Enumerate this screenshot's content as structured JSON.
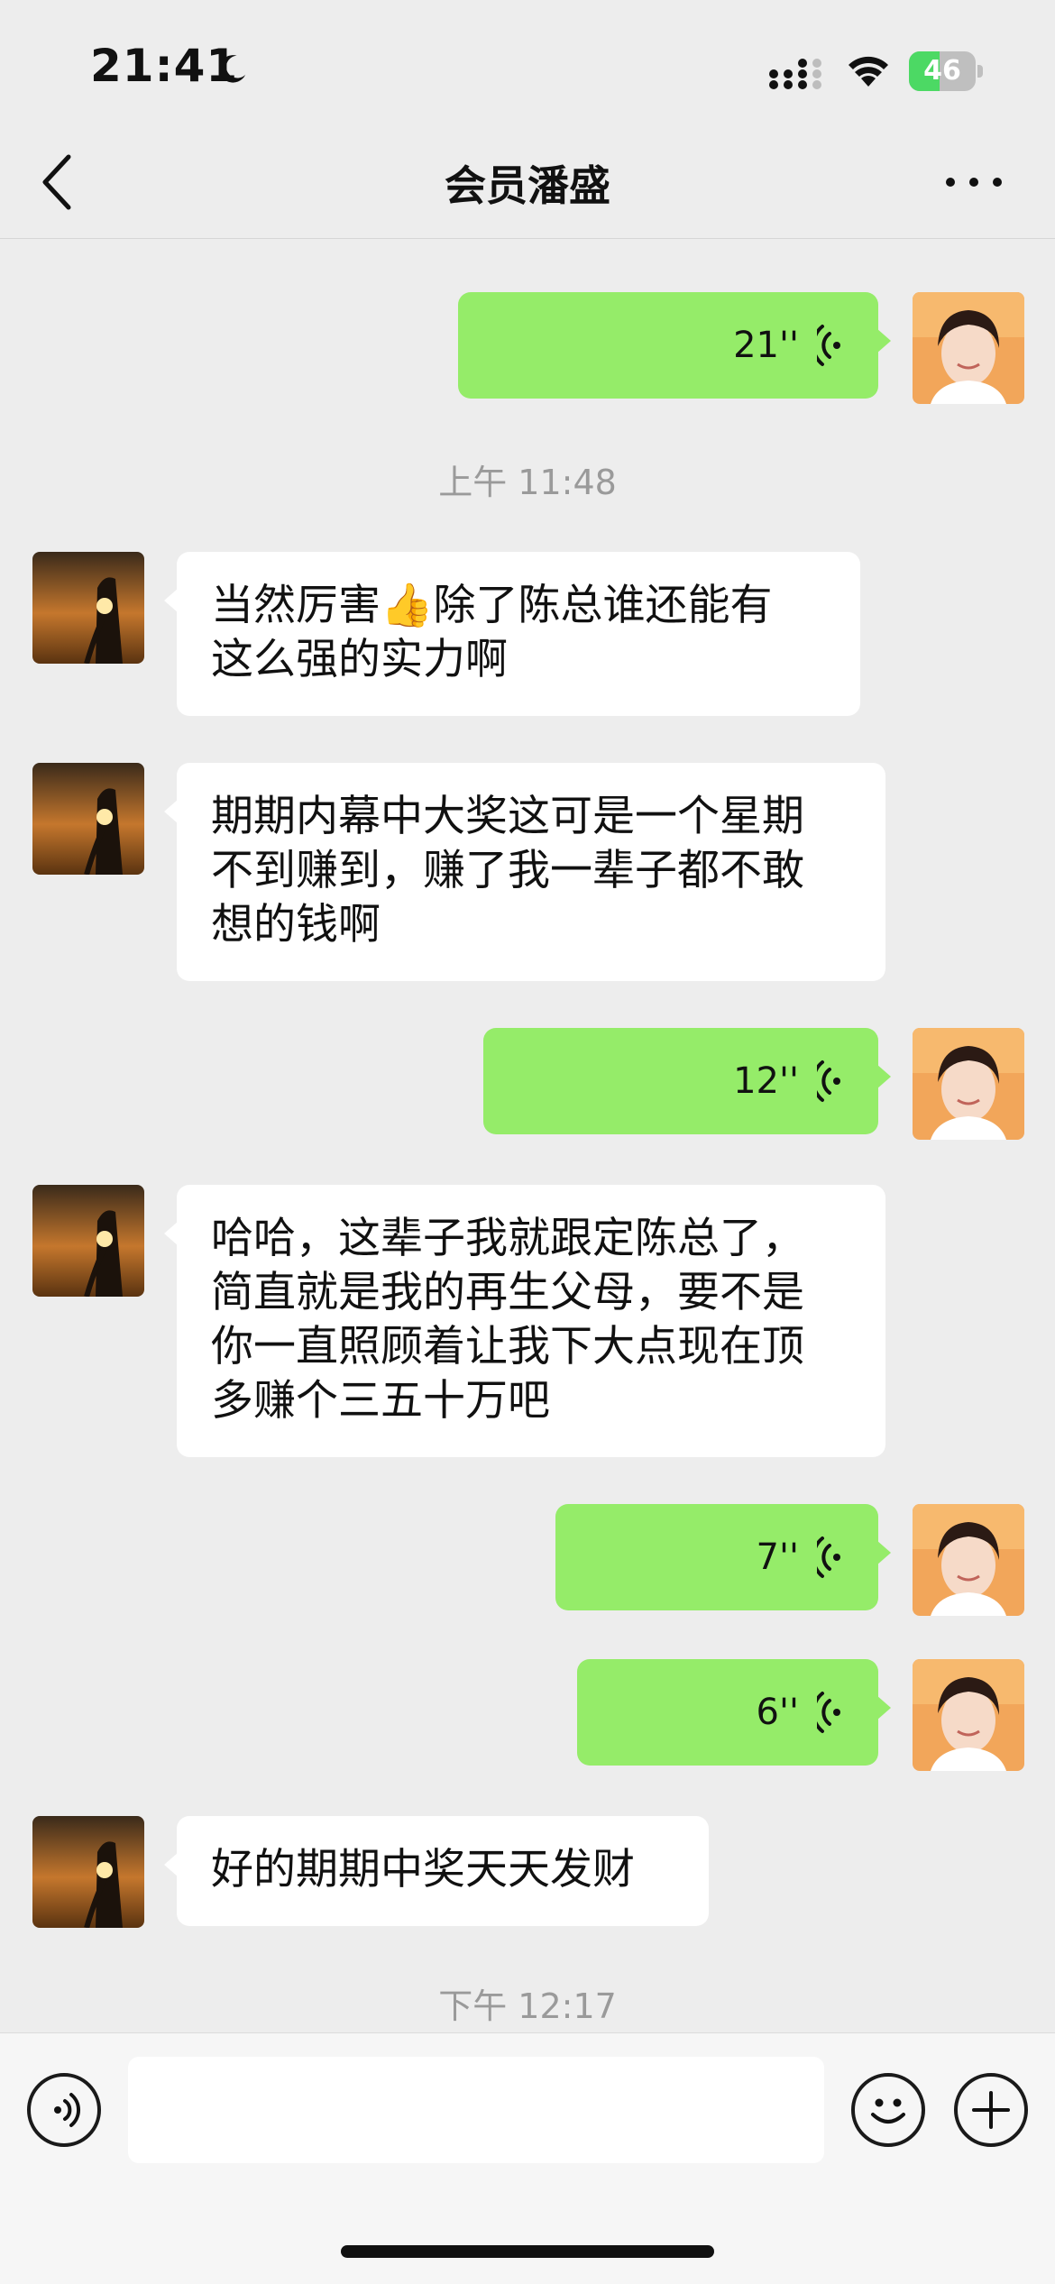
{
  "status": {
    "time": "21:41",
    "battery": "46",
    "battery_level": 0.46
  },
  "header": {
    "title": "会员潘盛"
  },
  "messages": [
    {
      "type": "voice",
      "side": "out",
      "duration": "21''"
    },
    {
      "type": "timestamp",
      "text": "上午 11:48"
    },
    {
      "type": "text",
      "side": "in",
      "text": "当然厉害👍除了陈总谁还能有\n这么强的实力啊"
    },
    {
      "type": "text",
      "side": "in",
      "text": "期期内幕中大奖这可是一个星期\n不到赚到，赚了我一辈子都不敢\n想的钱啊"
    },
    {
      "type": "voice",
      "side": "out",
      "duration": "12''"
    },
    {
      "type": "text",
      "side": "in",
      "text": "哈哈，这辈子我就跟定陈总了，\n简直就是我的再生父母，要不是\n你一直照顾着让我下大点现在顶\n多赚个三五十万吧"
    },
    {
      "type": "voice",
      "side": "out",
      "duration": "7''"
    },
    {
      "type": "voice",
      "side": "out",
      "duration": "6''"
    },
    {
      "type": "text",
      "side": "in",
      "text": "好的期期中奖天天发财"
    },
    {
      "type": "timestamp",
      "text": "下午 12:17"
    }
  ],
  "input": {
    "value": ""
  },
  "icons": {
    "back": "chevron-left-icon",
    "more": "more-dots-icon",
    "voice_toggle": "voice-mode-icon",
    "emoji": "emoji-icon",
    "add": "plus-icon"
  },
  "colors": {
    "outgoing_bubble": "#95ec69",
    "incoming_bubble": "#ffffff",
    "background": "#ededed"
  }
}
